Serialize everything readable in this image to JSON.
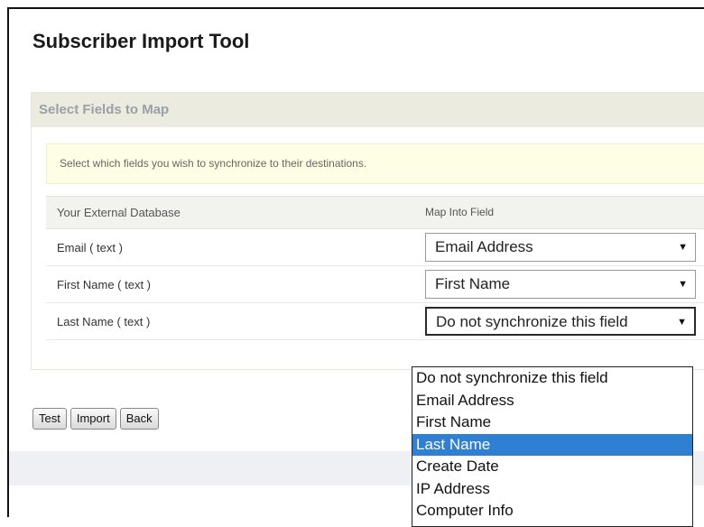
{
  "page": {
    "title": "Subscriber Import Tool"
  },
  "section": {
    "header": "Select Fields to Map",
    "hint": "Select which fields you wish to synchronize to their destinations.",
    "columns": [
      "Your External Database",
      "Map Into Field"
    ],
    "rows": [
      {
        "label": "Email ( text )",
        "value": "Email Address"
      },
      {
        "label": "First Name ( text )",
        "value": "First Name"
      },
      {
        "label": "Last Name ( text )",
        "value": "Do not synchronize this field"
      }
    ]
  },
  "dropdown": {
    "options": [
      "Do not synchronize this field",
      "Email Address",
      "First Name",
      "Last Name",
      "Create Date",
      "IP Address",
      "Computer Info"
    ],
    "highlighted": "Last Name"
  },
  "buttons": {
    "test": "Test",
    "import": "Import",
    "back": "Back"
  },
  "icons": {
    "select_arrow": "chevron-down-icon"
  },
  "colors": {
    "highlight": "#2f7fd2",
    "hint_bg": "#fefee4"
  }
}
